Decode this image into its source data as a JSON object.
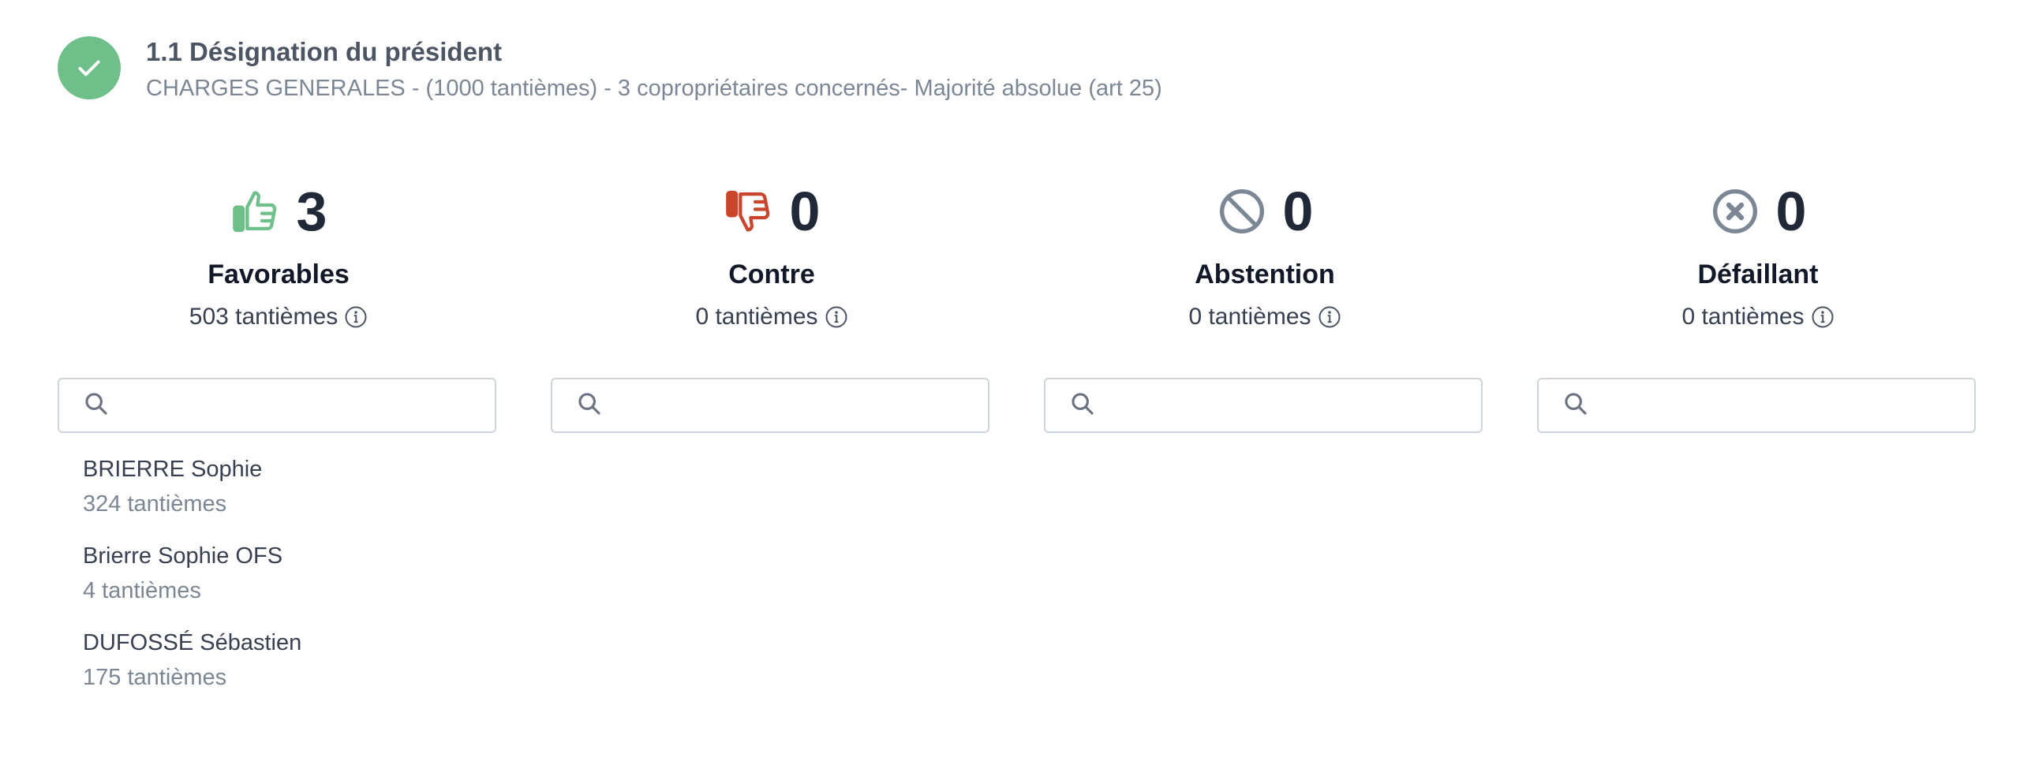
{
  "resolution": {
    "title": "1.1 Désignation du président",
    "subtitle": "CHARGES GENERALES - (1000 tantièmes) - 3 copropriétaires concernés- Majorité absolue (art 25)"
  },
  "columns": [
    {
      "icon": "thumbs-up-icon",
      "color": "#6fbf8a",
      "count": "3",
      "label": "Favorables",
      "tantiemes": "503 tantièmes",
      "voters": [
        {
          "name": "BRIERRE Sophie",
          "tantiemes": "324 tantièmes"
        },
        {
          "name": "Brierre Sophie OFS",
          "tantiemes": "4 tantièmes"
        },
        {
          "name": "DUFOSSÉ Sébastien",
          "tantiemes": "175 tantièmes"
        }
      ]
    },
    {
      "icon": "thumbs-down-icon",
      "color": "#c9462c",
      "count": "0",
      "label": "Contre",
      "tantiemes": "0 tantièmes",
      "voters": []
    },
    {
      "icon": "prohibited-icon",
      "color": "#7b8794",
      "count": "0",
      "label": "Abstention",
      "tantiemes": "0 tantièmes",
      "voters": []
    },
    {
      "icon": "x-circle-icon",
      "color": "#7b8794",
      "count": "0",
      "label": "Défaillant",
      "tantiemes": "0 tantièmes",
      "voters": []
    }
  ]
}
